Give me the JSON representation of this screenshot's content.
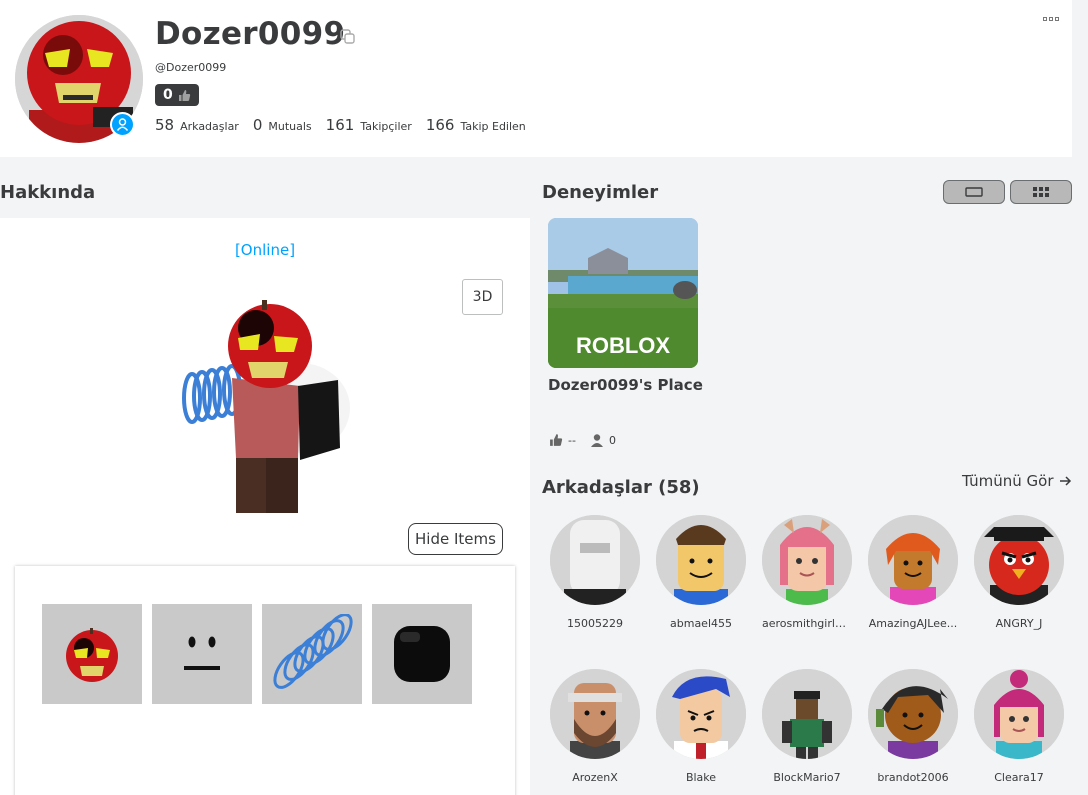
{
  "profile": {
    "display_name": "Dozer0099",
    "handle": "@Dozer0099",
    "badge_count": "0",
    "presence_icon": "person-icon",
    "stats": [
      {
        "num": "58",
        "label": "Arkadaşlar"
      },
      {
        "num": "0",
        "label": "Mutuals"
      },
      {
        "num": "161",
        "label": "Takipçiler"
      },
      {
        "num": "166",
        "label": "Takip Edilen"
      }
    ]
  },
  "about": {
    "title": "Hakkında",
    "status": "[Online]",
    "btn_3d": "3D",
    "hide_items": "Hide Items",
    "items": [
      "pumpkin-head-item",
      "face-item",
      "spring-item",
      "black-hair-item"
    ]
  },
  "experiences": {
    "title": "Deneyimler",
    "game": {
      "name": "Dozer0099's Place",
      "thumb_logo": "ROBLOX",
      "likes": "--",
      "players": "0"
    }
  },
  "friends": {
    "title": "Arkadaşlar (58)",
    "see_all": "Tümünü Gör",
    "list": [
      {
        "name": "15005229"
      },
      {
        "name": "abmael455"
      },
      {
        "name": "aerosmithgirl1..."
      },
      {
        "name": "AmazingAJLee..."
      },
      {
        "name": "ANGRY_J"
      },
      {
        "name": "ArozenX"
      },
      {
        "name": "Blake"
      },
      {
        "name": "BlockMario7"
      },
      {
        "name": "brandot2006"
      },
      {
        "name": "Cleara17"
      }
    ]
  },
  "colors": {
    "accent": "#00a2ff",
    "text": "#393b3d",
    "bg": "#f2f4f5"
  }
}
